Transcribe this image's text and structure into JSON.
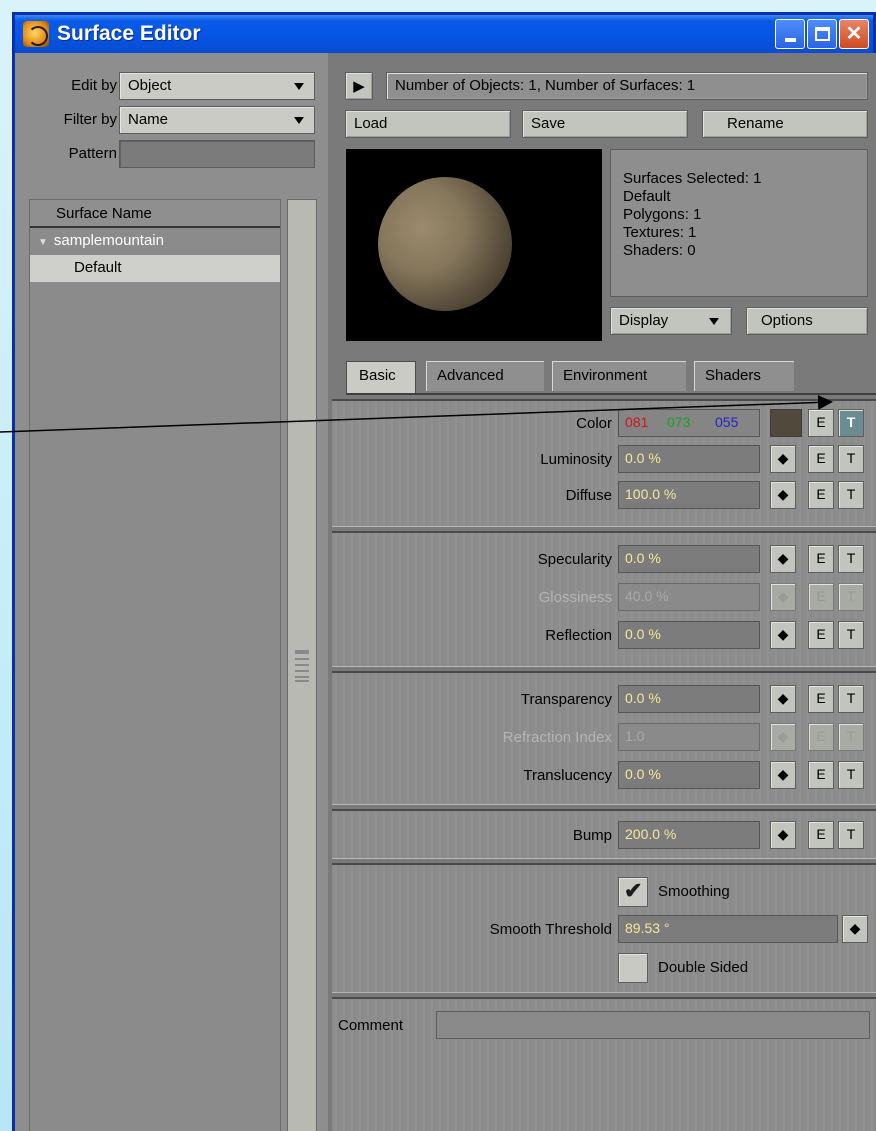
{
  "window": {
    "title": "Surface Editor",
    "buttons": [
      "minimize-icon",
      "maximize-icon",
      "close-icon"
    ],
    "close_glyph": "✕"
  },
  "left": {
    "edit_by_label": "Edit by",
    "edit_by_value": "Object",
    "filter_by_label": "Filter by",
    "filter_by_value": "Name",
    "pattern_label": "Pattern",
    "pattern_value": "",
    "list_header": "Surface Name",
    "group_name": "samplemountain",
    "items": [
      "Default"
    ]
  },
  "right": {
    "summary": "Number of Objects: 1, Number of Surfaces: 1",
    "load": "Load",
    "save": "Save",
    "rename": "Rename",
    "stats": [
      "Surfaces Selected: 1",
      "Default",
      "Polygons: 1",
      "Textures: 1",
      "Shaders: 0"
    ],
    "display": "Display",
    "options": "Options",
    "tabs": [
      "Basic",
      "Advanced",
      "Environment",
      "Shaders"
    ],
    "active_tab": "Basic"
  },
  "properties": {
    "color": {
      "label": "Color",
      "r": "081",
      "g": "073",
      "b": "055",
      "swatch": "#51493b"
    },
    "luminosity": {
      "label": "Luminosity",
      "value": "0.0 %"
    },
    "diffuse": {
      "label": "Diffuse",
      "value": "100.0 %"
    },
    "specularity": {
      "label": "Specularity",
      "value": "0.0 %"
    },
    "glossiness": {
      "label": "Glossiness",
      "value": "40.0 %"
    },
    "reflection": {
      "label": "Reflection",
      "value": "0.0 %"
    },
    "transparency": {
      "label": "Transparency",
      "value": "0.0 %"
    },
    "refraction_index": {
      "label": "Refraction Index",
      "value": "1.0"
    },
    "translucency": {
      "label": "Translucency",
      "value": "0.0 %"
    },
    "bump": {
      "label": "Bump",
      "value": "200.0 %"
    },
    "smoothing": {
      "label": "Smoothing",
      "checked": true
    },
    "smooth_threshold": {
      "label": "Smooth Threshold",
      "value": "89.53 °"
    },
    "double_sided": {
      "label": "Double Sided",
      "checked": false
    },
    "comment": {
      "label": "Comment",
      "value": ""
    }
  },
  "buttons": {
    "envelope": "E",
    "texture": "T",
    "slider": "◆",
    "play": "▶"
  },
  "colors": {
    "accent_title": "#0654e2",
    "value_text": "#f5e79a",
    "red": "#d0141a",
    "green": "#1aa11f",
    "blue": "#2424c8"
  }
}
